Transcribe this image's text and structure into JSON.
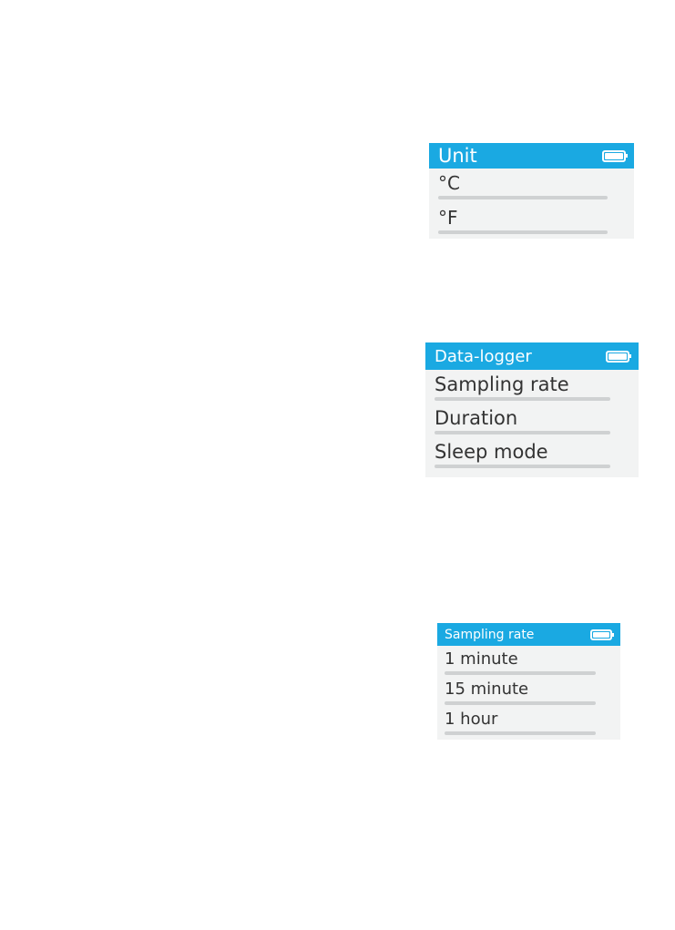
{
  "colors": {
    "header": "#1aa9e2",
    "screen_bg": "#f2f3f3",
    "separator": "#cfd1d2",
    "text": "#333333"
  },
  "screens": [
    {
      "title": "Unit",
      "battery_icon": "battery-full-icon",
      "items": [
        {
          "label": "°C"
        },
        {
          "label": "°F"
        }
      ]
    },
    {
      "title": "Data-logger",
      "battery_icon": "battery-full-icon",
      "items": [
        {
          "label": "Sampling rate"
        },
        {
          "label": "Duration"
        },
        {
          "label": "Sleep mode"
        }
      ]
    },
    {
      "title": "Sampling rate",
      "battery_icon": "battery-full-icon",
      "items": [
        {
          "label": "1 minute"
        },
        {
          "label": "15 minute"
        },
        {
          "label": "1 hour"
        }
      ]
    }
  ]
}
